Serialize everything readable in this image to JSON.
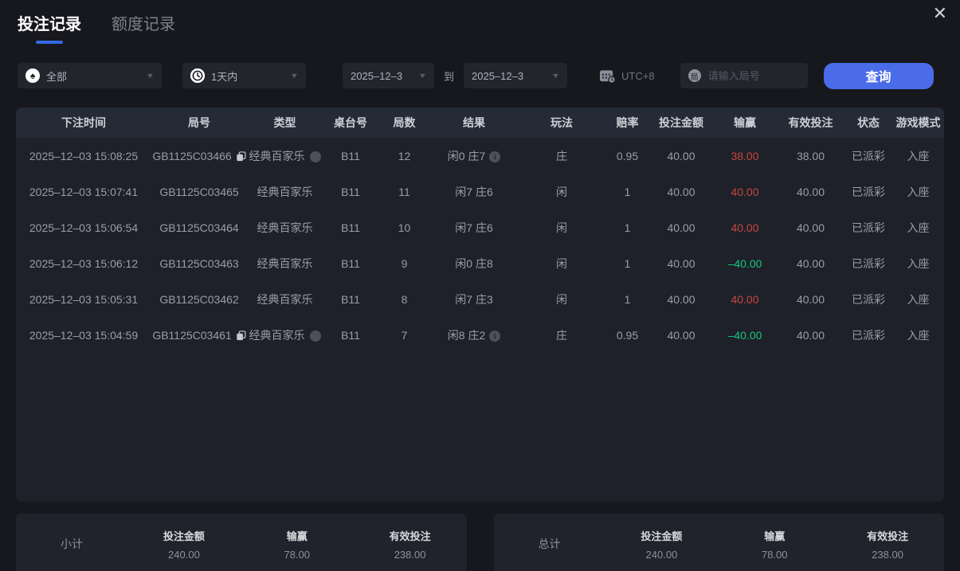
{
  "window": {
    "close_icon": "✕"
  },
  "tabs": [
    {
      "label": "投注记录",
      "active": true
    },
    {
      "label": "额度记录",
      "active": false
    }
  ],
  "filters": {
    "game_type_value": "全部",
    "spade_icon": "♠",
    "time_range_value": "1天内",
    "date_from": "2025–12–3",
    "to_label": "到",
    "date_to": "2025–12–3",
    "timezone": "UTC+8",
    "round_icon_char": "局",
    "round_input_placeholder": "请输入局号",
    "query_button": "查询",
    "chevron_icon": "▼"
  },
  "table": {
    "headers": [
      "下注时间",
      "局号",
      "类型",
      "桌台号",
      "局数",
      "结果",
      "玩法",
      "赔率",
      "投注金额",
      "输赢",
      "有效投注",
      "状态",
      "游戏模式"
    ],
    "rows": [
      {
        "time": "2025–12–03 15:08:25",
        "round_id": "GB1125C03466",
        "type": "经典百家乐",
        "table_no": "B11",
        "round_no": "12",
        "result": "闲0 庄7",
        "play": "庄",
        "odds": "0.95",
        "bet": "40.00",
        "win_loss": "38.00",
        "valid_bet": "38.00",
        "status": "已派彩",
        "mode": "入座"
      },
      {
        "time": "2025–12–03 15:07:41",
        "round_id": "GB1125C03465",
        "type": "经典百家乐",
        "table_no": "B11",
        "round_no": "11",
        "result": "闲7 庄6",
        "play": "闲",
        "odds": "1",
        "bet": "40.00",
        "win_loss": "40.00",
        "valid_bet": "40.00",
        "status": "已派彩",
        "mode": "入座"
      },
      {
        "time": "2025–12–03 15:06:54",
        "round_id": "GB1125C03464",
        "type": "经典百家乐",
        "table_no": "B11",
        "round_no": "10",
        "result": "闲7 庄6",
        "play": "闲",
        "odds": "1",
        "bet": "40.00",
        "win_loss": "40.00",
        "valid_bet": "40.00",
        "status": "已派彩",
        "mode": "入座"
      },
      {
        "time": "2025–12–03 15:06:12",
        "round_id": "GB1125C03463",
        "type": "经典百家乐",
        "table_no": "B11",
        "round_no": "9",
        "result": "闲0 庄8",
        "play": "闲",
        "odds": "1",
        "bet": "40.00",
        "win_loss": "–40.00",
        "valid_bet": "40.00",
        "status": "已派彩",
        "mode": "入座"
      },
      {
        "time": "2025–12–03 15:05:31",
        "round_id": "GB1125C03462",
        "type": "经典百家乐",
        "table_no": "B11",
        "round_no": "8",
        "result": "闲7 庄3",
        "play": "闲",
        "odds": "1",
        "bet": "40.00",
        "win_loss": "40.00",
        "valid_bet": "40.00",
        "status": "已派彩",
        "mode": "入座"
      },
      {
        "time": "2025–12–03 15:04:59",
        "round_id": "GB1125C03461",
        "type": "经典百家乐",
        "table_no": "B11",
        "round_no": "7",
        "result": "闲8 庄2",
        "play": "庄",
        "odds": "0.95",
        "bet": "40.00",
        "win_loss": "–40.00",
        "valid_bet": "40.00",
        "status": "已派彩",
        "mode": "入座"
      }
    ],
    "info_icon_char": "i"
  },
  "summary": {
    "subtotal": {
      "label": "小计",
      "bet_label": "投注金额",
      "bet": "240.00",
      "win_label": "输赢",
      "win": "78.00",
      "valid_label": "有效投注",
      "valid": "238.00"
    },
    "total": {
      "label": "总计",
      "bet_label": "投注金额",
      "bet": "240.00",
      "win_label": "输赢",
      "win": "78.00",
      "valid_label": "有效投注",
      "valid": "238.00"
    }
  },
  "colors": {
    "accent_blue": "#4a6ce8",
    "tab_underline": "#3568e4",
    "positive_red": "#c8463c",
    "negative_green": "#17c57e",
    "page_bg": "#17181d",
    "table_bg": "#1e2129",
    "header_row_bg": "#242a36"
  }
}
